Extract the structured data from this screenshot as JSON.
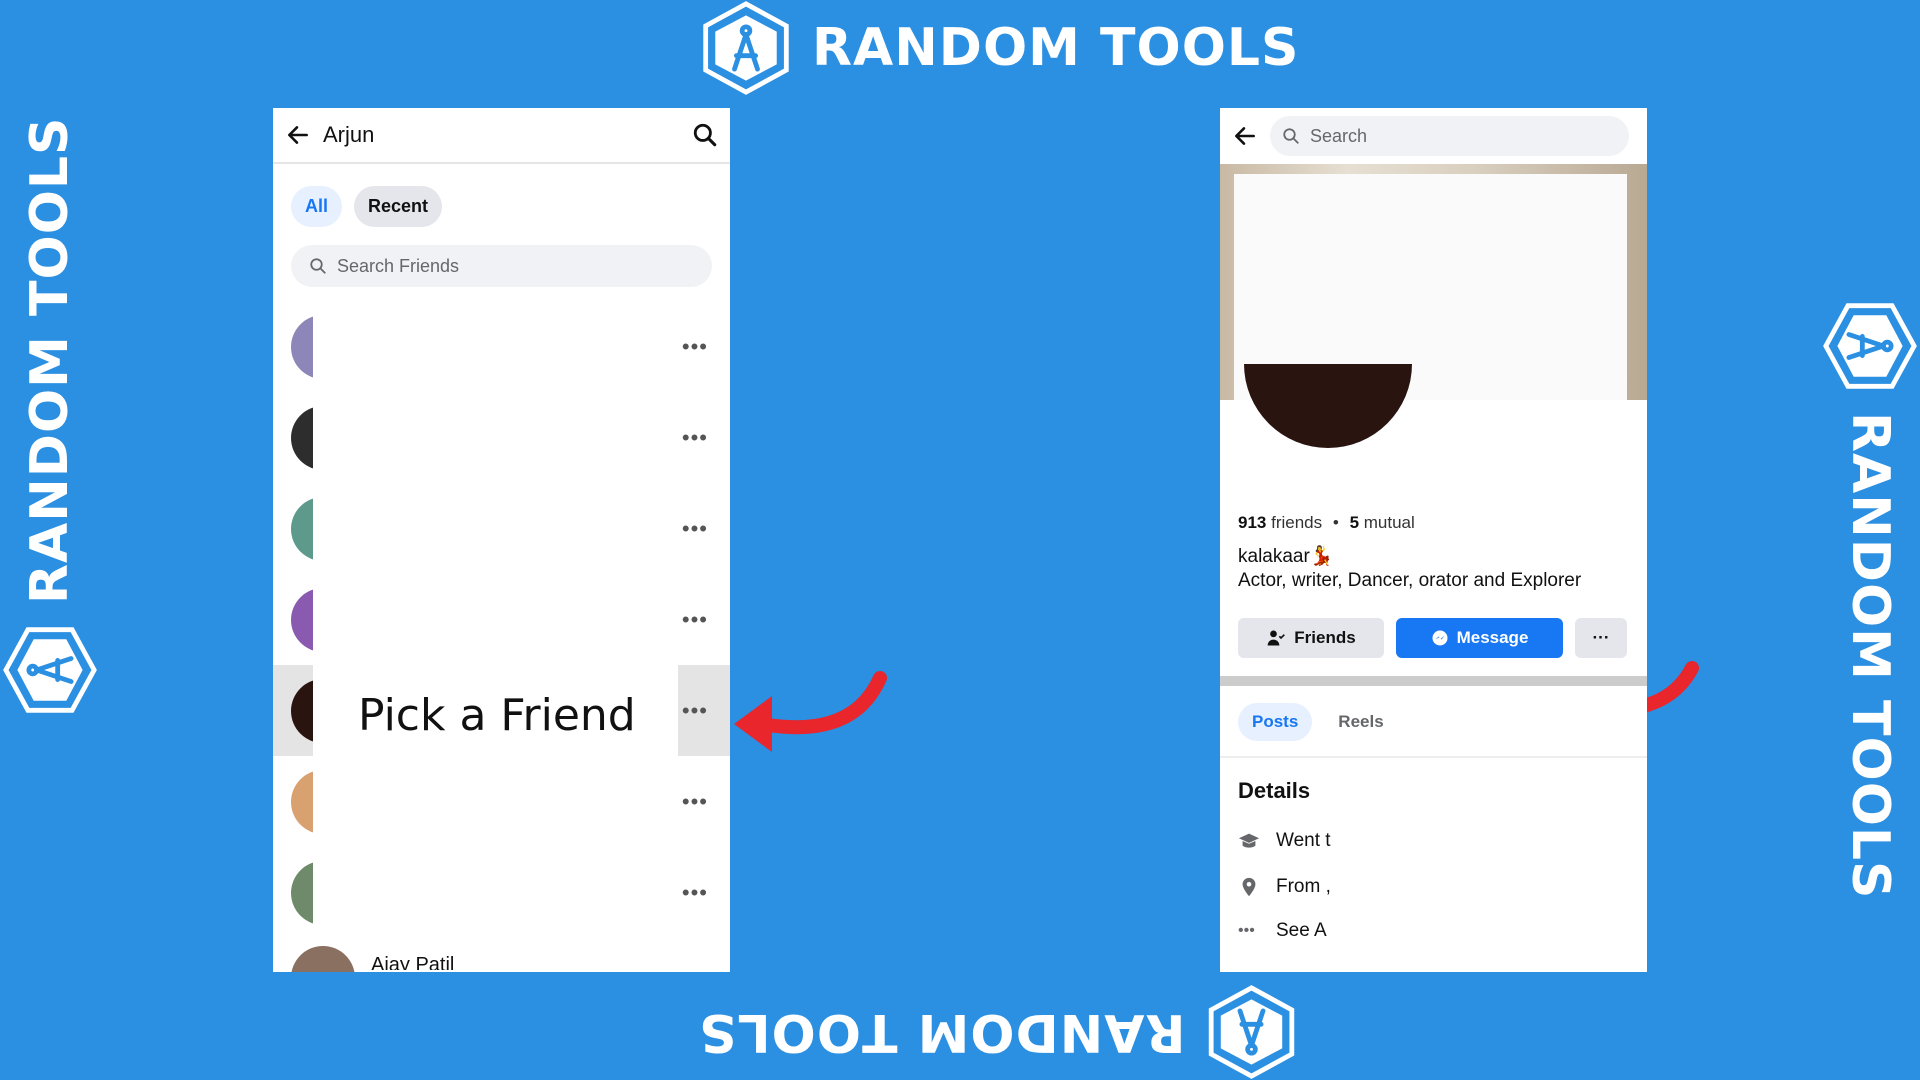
{
  "brand": {
    "text": "RANDOM TOOLS",
    "color": "#ffffff",
    "background": "#2b8fe2"
  },
  "left_screen": {
    "title": "Arjun",
    "tabs": {
      "all": "All",
      "recent": "Recent"
    },
    "search_placeholder": "Search Friends",
    "more_glyph": "•••",
    "selected_row_index": 5,
    "overlay_label": "Pick a Friend",
    "partial_last_name": "Ajay Patil"
  },
  "right_screen": {
    "search_placeholder": "Search",
    "friends_count": "913",
    "friends_word": "friends",
    "mutual_count": "5",
    "mutual_word": "mutual",
    "dot_sep": "•",
    "bio_name": "kalakaar💃",
    "bio_text": "Actor, writer, Dancer, orator and Explorer",
    "buttons": {
      "friends": "Friends",
      "message": "Message",
      "more": "···"
    },
    "tabs": {
      "posts": "Posts",
      "reels": "Reels"
    },
    "details_title": "Details",
    "details": {
      "education": "Went t",
      "location": "From ,",
      "see_all": "See A"
    },
    "accent_color": "#1877f2"
  }
}
